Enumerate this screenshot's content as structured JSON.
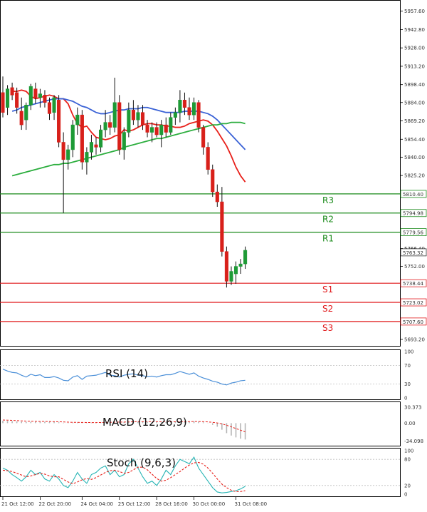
{
  "chart_data": [
    {
      "type": "candlestick",
      "panel": "price",
      "ylim": [
        5688.0,
        5966.0
      ],
      "y_ticks": [
        5957.6,
        5942.8,
        5928.0,
        5913.2,
        5898.4,
        5884.0,
        5869.2,
        5854.4,
        5840.0,
        5825.2,
        5766.4,
        5752.0,
        5693.2
      ],
      "last_price": "5763.32",
      "x_labels": [
        "21 Oct 12:00",
        "22 Oct 20:00",
        "24 Oct 04:00",
        "25 Oct 12:00",
        "28 Oct 16:00",
        "30 Oct 00:00",
        "31 Oct 08:00"
      ],
      "candles": [
        {
          "o": 5892,
          "h": 5905,
          "l": 5872,
          "c": 5876
        },
        {
          "o": 5880,
          "h": 5898,
          "l": 5874,
          "c": 5895
        },
        {
          "o": 5896,
          "h": 5900,
          "l": 5886,
          "c": 5890
        },
        {
          "o": 5892,
          "h": 5896,
          "l": 5875,
          "c": 5880
        },
        {
          "o": 5877,
          "h": 5888,
          "l": 5862,
          "c": 5866
        },
        {
          "o": 5870,
          "h": 5884,
          "l": 5862,
          "c": 5882
        },
        {
          "o": 5882,
          "h": 5899,
          "l": 5878,
          "c": 5897
        },
        {
          "o": 5895,
          "h": 5900,
          "l": 5883,
          "c": 5888
        },
        {
          "o": 5888,
          "h": 5895,
          "l": 5880,
          "c": 5891
        },
        {
          "o": 5890,
          "h": 5894,
          "l": 5880,
          "c": 5884
        },
        {
          "o": 5884,
          "h": 5888,
          "l": 5870,
          "c": 5875
        },
        {
          "o": 5876,
          "h": 5890,
          "l": 5870,
          "c": 5888
        },
        {
          "o": 5886,
          "h": 5890,
          "l": 5848,
          "c": 5852
        },
        {
          "o": 5852,
          "h": 5860,
          "l": 5795,
          "c": 5838
        },
        {
          "o": 5838,
          "h": 5850,
          "l": 5830,
          "c": 5846
        },
        {
          "o": 5846,
          "h": 5870,
          "l": 5840,
          "c": 5866
        },
        {
          "o": 5866,
          "h": 5880,
          "l": 5858,
          "c": 5874
        },
        {
          "o": 5874,
          "h": 5878,
          "l": 5830,
          "c": 5836
        },
        {
          "o": 5836,
          "h": 5848,
          "l": 5826,
          "c": 5844
        },
        {
          "o": 5844,
          "h": 5858,
          "l": 5838,
          "c": 5852
        },
        {
          "o": 5850,
          "h": 5856,
          "l": 5842,
          "c": 5848
        },
        {
          "o": 5848,
          "h": 5866,
          "l": 5844,
          "c": 5862
        },
        {
          "o": 5862,
          "h": 5878,
          "l": 5856,
          "c": 5868
        },
        {
          "o": 5868,
          "h": 5874,
          "l": 5858,
          "c": 5864
        },
        {
          "o": 5864,
          "h": 5904,
          "l": 5860,
          "c": 5884
        },
        {
          "o": 5884,
          "h": 5890,
          "l": 5842,
          "c": 5846
        },
        {
          "o": 5846,
          "h": 5864,
          "l": 5838,
          "c": 5860
        },
        {
          "o": 5860,
          "h": 5884,
          "l": 5856,
          "c": 5878
        },
        {
          "o": 5878,
          "h": 5886,
          "l": 5866,
          "c": 5870
        },
        {
          "o": 5870,
          "h": 5882,
          "l": 5864,
          "c": 5876
        },
        {
          "o": 5876,
          "h": 5882,
          "l": 5862,
          "c": 5866
        },
        {
          "o": 5866,
          "h": 5870,
          "l": 5856,
          "c": 5860
        },
        {
          "o": 5860,
          "h": 5868,
          "l": 5852,
          "c": 5864
        },
        {
          "o": 5864,
          "h": 5868,
          "l": 5856,
          "c": 5858
        },
        {
          "o": 5858,
          "h": 5870,
          "l": 5848,
          "c": 5866
        },
        {
          "o": 5866,
          "h": 5872,
          "l": 5856,
          "c": 5860
        },
        {
          "o": 5860,
          "h": 5876,
          "l": 5858,
          "c": 5872
        },
        {
          "o": 5872,
          "h": 5880,
          "l": 5866,
          "c": 5876
        },
        {
          "o": 5876,
          "h": 5894,
          "l": 5868,
          "c": 5886
        },
        {
          "o": 5886,
          "h": 5892,
          "l": 5874,
          "c": 5880
        },
        {
          "o": 5880,
          "h": 5888,
          "l": 5870,
          "c": 5874
        },
        {
          "o": 5874,
          "h": 5888,
          "l": 5870,
          "c": 5884
        },
        {
          "o": 5884,
          "h": 5886,
          "l": 5860,
          "c": 5864
        },
        {
          "o": 5864,
          "h": 5866,
          "l": 5842,
          "c": 5848
        },
        {
          "o": 5848,
          "h": 5852,
          "l": 5826,
          "c": 5830
        },
        {
          "o": 5830,
          "h": 5834,
          "l": 5808,
          "c": 5812
        },
        {
          "o": 5812,
          "h": 5818,
          "l": 5800,
          "c": 5804
        },
        {
          "o": 5804,
          "h": 5816,
          "l": 5760,
          "c": 5764
        },
        {
          "o": 5764,
          "h": 5768,
          "l": 5735,
          "c": 5740
        },
        {
          "o": 5740,
          "h": 5752,
          "l": 5737,
          "c": 5748
        },
        {
          "o": 5746,
          "h": 5756,
          "l": 5738,
          "c": 5752
        },
        {
          "o": 5752,
          "h": 5758,
          "l": 5746,
          "c": 5754
        },
        {
          "o": 5754,
          "h": 5768,
          "l": 5750,
          "c": 5765
        }
      ],
      "overlays": [
        {
          "color": "#e8201a",
          "values": [
            5893,
            5893,
            5894,
            5893,
            5889,
            5887,
            5888,
            5889,
            5890,
            5889,
            5887,
            5887,
            5883,
            5874,
            5867,
            5864,
            5865,
            5860,
            5856,
            5855,
            5854,
            5855,
            5857,
            5858,
            5862,
            5861,
            5862,
            5864,
            5866,
            5867,
            5867,
            5866,
            5866,
            5865,
            5865,
            5864,
            5864,
            5865,
            5867,
            5868,
            5869,
            5870,
            5869,
            5866,
            5861,
            5855,
            5849,
            5841,
            5832,
            5825,
            5820
          ]
        },
        {
          "color": "#3a62d6",
          "values": [
            5877,
            5878,
            5880,
            5881,
            5882,
            5883,
            5884,
            5885,
            5886,
            5887,
            5887,
            5887,
            5886,
            5885,
            5883,
            5881,
            5880,
            5878,
            5876,
            5875,
            5875,
            5876,
            5877,
            5878,
            5878,
            5879,
            5879,
            5879,
            5880,
            5880,
            5879,
            5878,
            5877,
            5876,
            5876,
            5876,
            5876,
            5877,
            5877,
            5877,
            5877,
            5876,
            5875,
            5873,
            5870,
            5866,
            5862,
            5858,
            5854,
            5850,
            5846
          ]
        },
        {
          "color": "#2cae3e",
          "values": [
            5825,
            5826,
            5827,
            5828,
            5829,
            5830,
            5831,
            5832,
            5833,
            5834,
            5834,
            5835,
            5835,
            5836,
            5837,
            5838,
            5839,
            5840,
            5841,
            5842,
            5843,
            5844,
            5845,
            5846,
            5848,
            5849,
            5850,
            5851,
            5852,
            5853,
            5854,
            5855,
            5855,
            5856,
            5857,
            5858,
            5859,
            5860,
            5861,
            5862,
            5863,
            5864,
            5865,
            5866,
            5866,
            5867,
            5867,
            5868,
            5868,
            5868,
            5867
          ]
        }
      ],
      "levels": [
        {
          "name": "R3",
          "value": 5810.4,
          "color": "#1a8a1a"
        },
        {
          "name": "R2",
          "value": 5794.98,
          "color": "#1a8a1a"
        },
        {
          "name": "R1",
          "value": 5779.56,
          "color": "#1a8a1a"
        },
        {
          "name": "S1",
          "value": 5738.44,
          "color": "#e0181a"
        },
        {
          "name": "S2",
          "value": 5723.02,
          "color": "#e0181a"
        },
        {
          "name": "S3",
          "value": 5707.6,
          "color": "#e0181a"
        }
      ]
    },
    {
      "type": "line",
      "panel": "rsi",
      "title": "RSI (14)",
      "ylim": [
        0,
        100
      ],
      "y_ticks": [
        100,
        70,
        30,
        0
      ],
      "series": [
        {
          "color": "#4a8fd8",
          "values": [
            62,
            58,
            55,
            54,
            49,
            45,
            51,
            48,
            50,
            44,
            44,
            46,
            43,
            38,
            37,
            45,
            48,
            40,
            47,
            48,
            49,
            52,
            55,
            49,
            48,
            45,
            49,
            51,
            52,
            49,
            48,
            46,
            47,
            45,
            48,
            50,
            50,
            53,
            57,
            54,
            51,
            54,
            47,
            43,
            40,
            36,
            34,
            30,
            28,
            32,
            34,
            37,
            38
          ]
        }
      ]
    },
    {
      "type": "bar",
      "panel": "macd",
      "title": "MACD (12,26,9)",
      "ylim": [
        -40.0,
        37.0
      ],
      "y_ticks": [
        "30.373",
        "0.00",
        "-34.098"
      ],
      "histogram": [
        4.5,
        4.2,
        3.8,
        3.3,
        2.7,
        2.4,
        2.5,
        2.6,
        2.8,
        2.7,
        2.4,
        2.3,
        1.6,
        0.8,
        0.5,
        0.9,
        1.3,
        0.8,
        0.6,
        0.8,
        1.0,
        1.5,
        2.0,
        2.2,
        2.8,
        2.6,
        2.6,
        3.0,
        3.3,
        3.3,
        3.1,
        2.7,
        2.5,
        2.3,
        2.3,
        2.3,
        2.5,
        2.8,
        3.3,
        3.4,
        3.4,
        3.5,
        2.8,
        1.6,
        -0.4,
        -3.4,
        -6.8,
        -12.5,
        -19.0,
        -23.5,
        -27.0,
        -29.5,
        -31.0
      ],
      "signal": [
        6.0,
        5.6,
        5.2,
        4.8,
        4.3,
        3.9,
        3.6,
        3.4,
        3.3,
        3.2,
        3.0,
        2.8,
        2.6,
        2.3,
        1.9,
        1.6,
        1.5,
        1.4,
        1.2,
        1.1,
        1.1,
        1.2,
        1.4,
        1.6,
        1.8,
        2.0,
        2.1,
        2.3,
        2.5,
        2.7,
        2.8,
        2.9,
        2.9,
        2.8,
        2.7,
        2.7,
        2.6,
        2.6,
        2.7,
        2.8,
        2.9,
        3.0,
        3.0,
        2.8,
        2.3,
        1.6,
        0.4,
        -1.4,
        -4.0,
        -7.0,
        -10.2,
        -13.4,
        -16.5
      ]
    },
    {
      "type": "line",
      "panel": "stoch",
      "title": "Stoch (9,6,3)",
      "ylim": [
        0,
        100
      ],
      "y_ticks": [
        100,
        80,
        20,
        0
      ],
      "series": [
        {
          "color": "#26b4b4",
          "values": [
            60,
            55,
            45,
            38,
            30,
            40,
            55,
            45,
            50,
            35,
            30,
            45,
            35,
            20,
            15,
            30,
            50,
            35,
            25,
            45,
            50,
            60,
            65,
            45,
            55,
            40,
            45,
            70,
            80,
            60,
            40,
            25,
            30,
            20,
            35,
            55,
            45,
            65,
            80,
            75,
            70,
            85,
            60,
            45,
            30,
            15,
            5,
            3,
            4,
            6,
            8,
            12,
            18
          ]
        },
        {
          "color": "#e8201a",
          "dashed": true,
          "values": [
            55,
            54,
            52,
            48,
            44,
            40,
            42,
            45,
            48,
            46,
            42,
            40,
            40,
            34,
            28,
            24,
            28,
            33,
            36,
            34,
            38,
            44,
            50,
            54,
            55,
            52,
            48,
            50,
            56,
            62,
            62,
            56,
            46,
            36,
            30,
            32,
            38,
            45,
            52,
            60,
            67,
            72,
            73,
            69,
            60,
            48,
            35,
            23,
            15,
            9,
            6,
            6,
            8
          ]
        }
      ]
    }
  ]
}
